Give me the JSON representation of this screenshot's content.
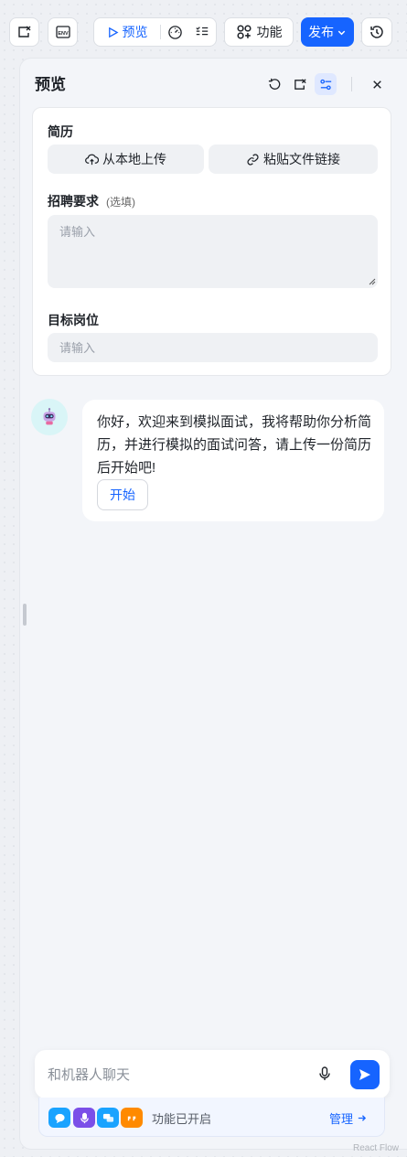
{
  "toolbar": {
    "preview_label": "预览",
    "features_label": "功能",
    "publish_label": "发布",
    "env_label": "ENV"
  },
  "panel": {
    "title": "预览"
  },
  "form": {
    "resume_label": "简历",
    "upload_local_label": "从本地上传",
    "paste_link_label": "粘贴文件链接",
    "requirements_label": "招聘要求",
    "requirements_optional": "(选填)",
    "requirements_placeholder": "请输入",
    "position_label": "目标岗位",
    "position_placeholder": "请输入"
  },
  "chat": {
    "bot_message": "你好，欢迎来到模拟面试，我将帮助你分析简历，并进行模拟的面试问答，请上传一份简历后开始吧!",
    "start_label": "开始"
  },
  "composer": {
    "placeholder": "和机器人聊天"
  },
  "feature_bar": {
    "status": "功能已开启",
    "manage_label": "管理",
    "icons": [
      "chat-bubble-icon",
      "microphone-icon",
      "messages-icon",
      "quote-icon"
    ],
    "icon_colors": [
      "#1aa3ff",
      "#7b4fe8",
      "#1aa3ff",
      "#ff8a00"
    ]
  },
  "watermark": "React Flow",
  "colors": {
    "accent": "#1664ff",
    "panel_bg": "#f3f5f9"
  }
}
